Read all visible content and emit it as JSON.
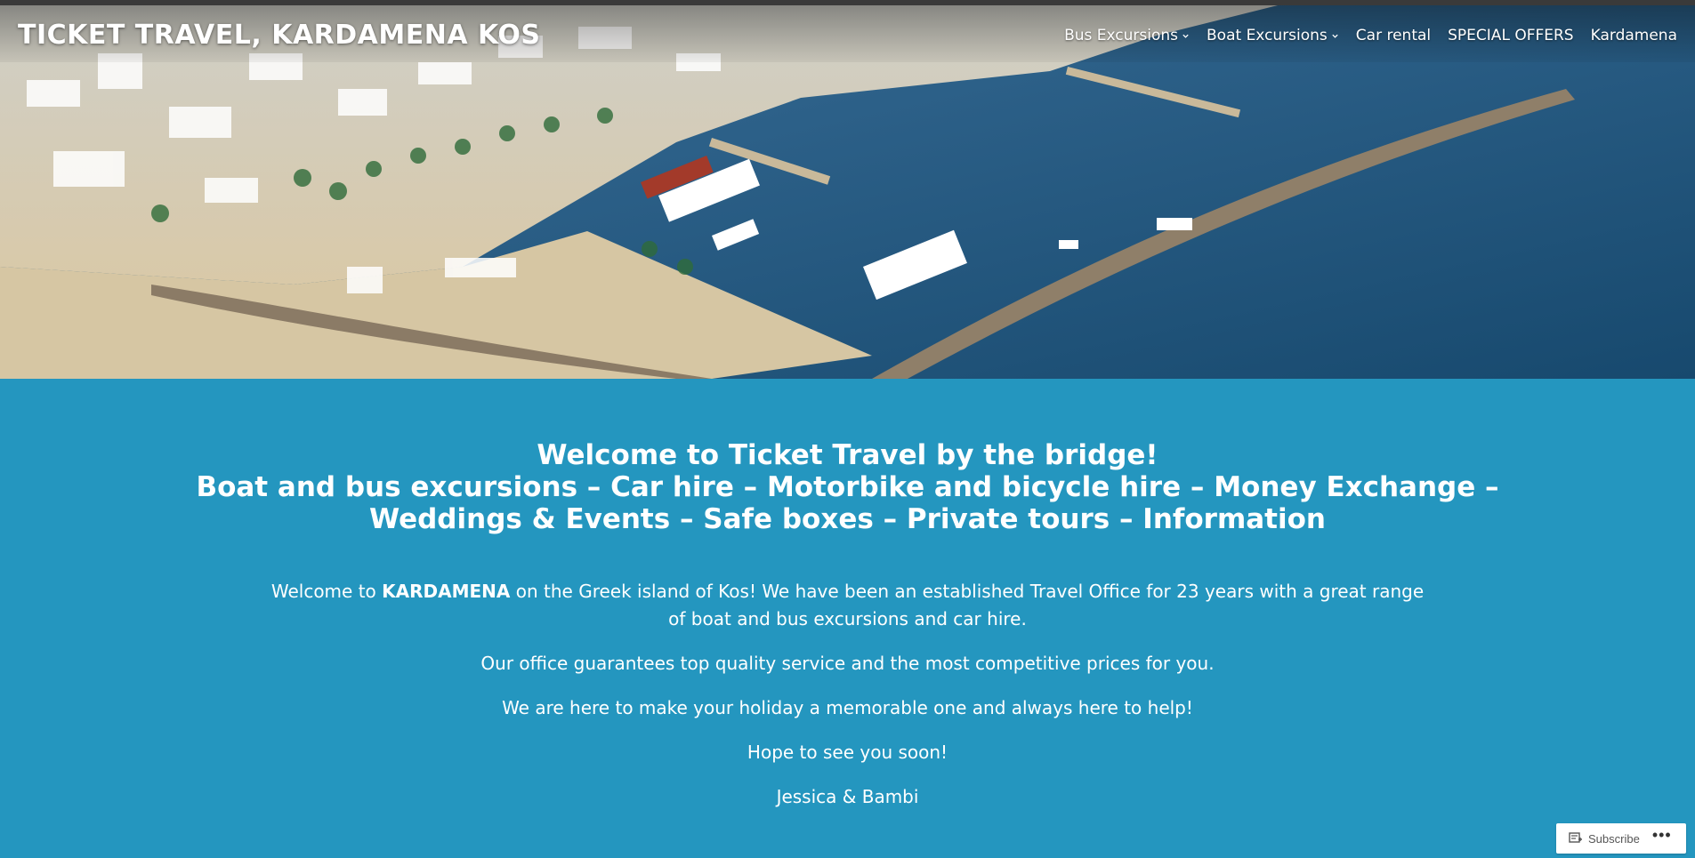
{
  "header": {
    "site_title": "TICKET TRAVEL, KARDAMENA KOS",
    "nav": [
      {
        "label": "Bus Excursions",
        "has_dropdown": true
      },
      {
        "label": "Boat Excursions",
        "has_dropdown": true
      },
      {
        "label": "Car rental",
        "has_dropdown": false
      },
      {
        "label": "SPECIAL OFFERS",
        "has_dropdown": false
      },
      {
        "label": "Kardamena",
        "has_dropdown": false
      }
    ]
  },
  "hero": {
    "image": "aerial-harbor-photo"
  },
  "main": {
    "headline": [
      "Welcome to Ticket Travel by the bridge!",
      "Boat and bus excursions – Car hire  – Motorbike and bicycle hire – Money Exchange  –",
      "Weddings & Events – Safe boxes – Private tours – Information"
    ],
    "intro_before": "Welcome to ",
    "intro_bold": "KARDAMENA",
    "intro_after": " on the Greek island of Kos! We have been an established Travel Office for 23 years with a great range of boat and bus excursions and car hire.",
    "paragraph2": "Our office guarantees top quality service  and the most competitive prices for you.",
    "paragraph3": "We are here to make your holiday a memorable one and always here to help!",
    "paragraph4": "Hope to see you soon!",
    "signature": "Jessica & Bambi"
  },
  "footer_widget": {
    "subscribe_label": "Subscribe",
    "more_label": "•••"
  },
  "colors": {
    "background": "#2496bf",
    "text": "#ffffff"
  }
}
